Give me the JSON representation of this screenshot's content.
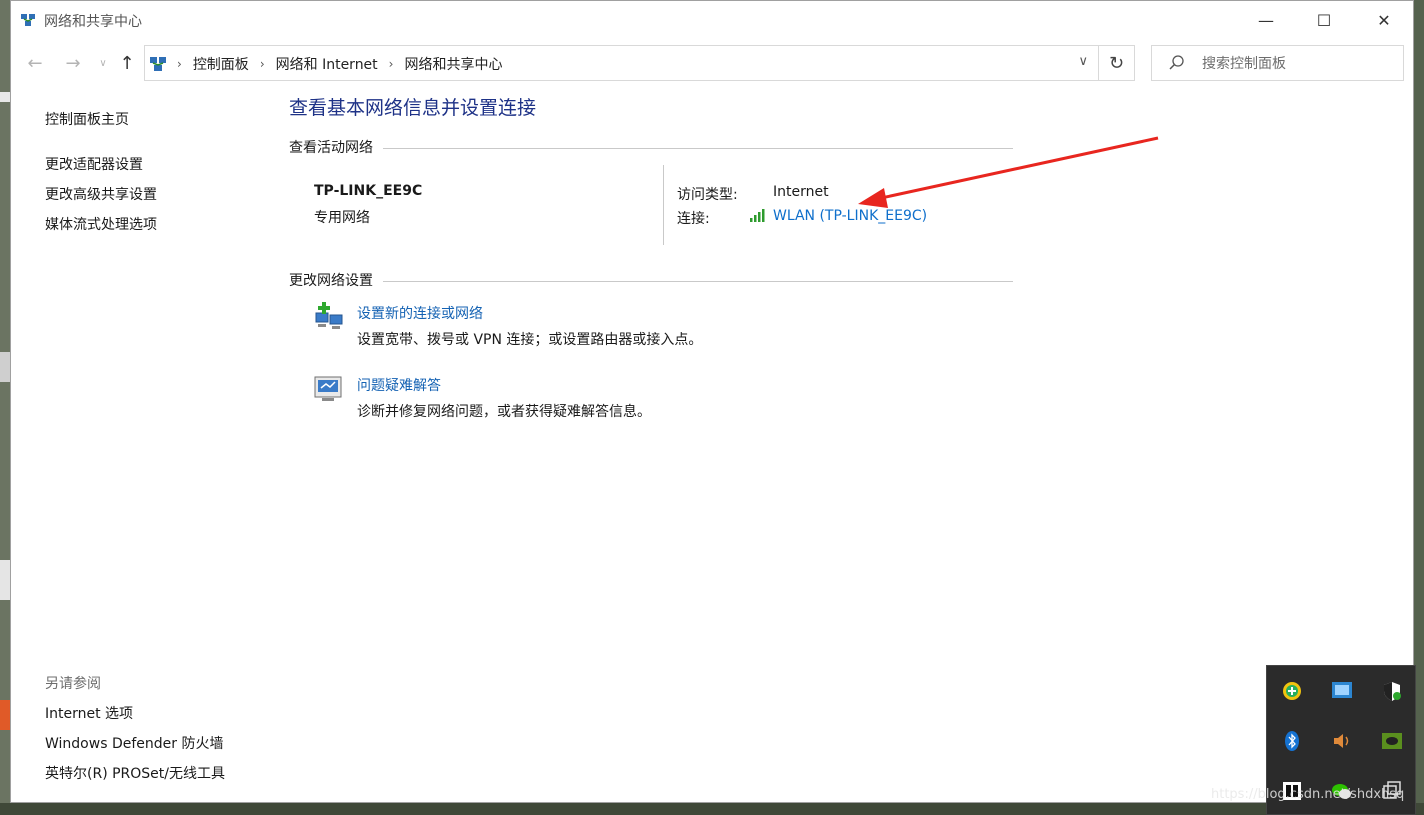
{
  "window": {
    "title": "网络和共享中心",
    "minimize_glyph": "—",
    "maximize_glyph": "☐",
    "close_glyph": "✕"
  },
  "nav": {
    "back_glyph": "←",
    "forward_glyph": "→",
    "recent_glyph": "∨",
    "up_glyph": "↑",
    "breadcrumb": [
      "控制面板",
      "网络和 Internet",
      "网络和共享中心"
    ],
    "breadcrumb_sep": "›",
    "dropdown_glyph": "∨",
    "refresh_glyph": "↻",
    "search_placeholder": "搜索控制面板"
  },
  "sidebar": {
    "home": "控制面板主页",
    "items": [
      "更改适配器设置",
      "更改高级共享设置",
      "媒体流式处理选项"
    ],
    "see_also_heading": "另请参阅",
    "see_also": [
      "Internet 选项",
      "Windows Defender 防火墙",
      "英特尔(R) PROSet/无线工具"
    ]
  },
  "main": {
    "title": "查看基本网络信息并设置连接",
    "active_heading": "查看活动网络",
    "network": {
      "name": "TP-LINK_EE9C",
      "type": "专用网络",
      "access_label": "访问类型:",
      "access_value": "Internet",
      "conn_label": "连接:",
      "conn_value": "WLAN (TP-LINK_EE9C)"
    },
    "change_heading": "更改网络设置",
    "tasks": [
      {
        "title": "设置新的连接或网络",
        "desc": "设置宽带、拨号或 VPN 连接；或设置路由器或接入点。",
        "icon": "new-connection-icon"
      },
      {
        "title": "问题疑难解答",
        "desc": "诊断并修复网络问题，或者获得疑难解答信息。",
        "icon": "troubleshoot-icon"
      }
    ]
  },
  "colors": {
    "title_blue": "#1e3287",
    "link_blue": "#0f6fcb",
    "annotation_red": "#e8261f"
  },
  "watermark": "https://blog.csdn.net/shdxhsq"
}
